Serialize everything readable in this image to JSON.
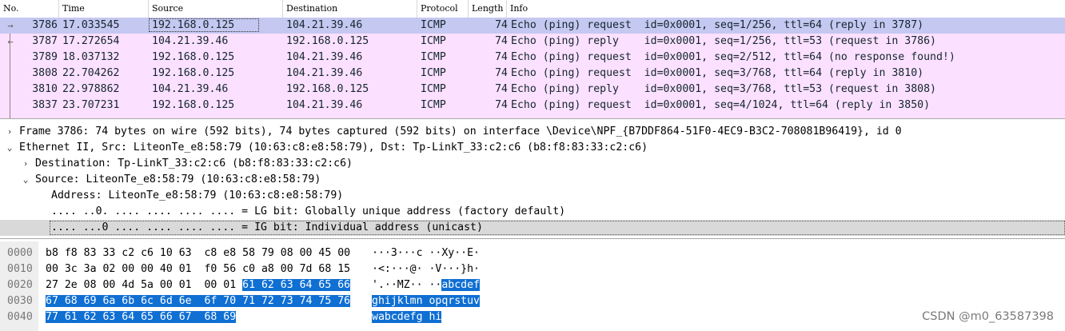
{
  "packet_list": {
    "columns": [
      "No.",
      "Time",
      "Source",
      "Destination",
      "Protocol",
      "Length",
      "Info"
    ],
    "rows": [
      {
        "no": "3786",
        "time": "17.033545",
        "src": "192.168.0.125",
        "dst": "104.21.39.46",
        "proto": "ICMP",
        "len": "74",
        "info": "Echo (ping) request  id=0x0001, seq=1/256, ttl=64 (reply in 3787)",
        "selected": true
      },
      {
        "no": "3787",
        "time": "17.272654",
        "src": "104.21.39.46",
        "dst": "192.168.0.125",
        "proto": "ICMP",
        "len": "74",
        "info": "Echo (ping) reply    id=0x0001, seq=1/256, ttl=53 (request in 3786)"
      },
      {
        "no": "3789",
        "time": "18.037132",
        "src": "192.168.0.125",
        "dst": "104.21.39.46",
        "proto": "ICMP",
        "len": "74",
        "info": "Echo (ping) request  id=0x0001, seq=2/512, ttl=64 (no response found!)"
      },
      {
        "no": "3808",
        "time": "22.704262",
        "src": "192.168.0.125",
        "dst": "104.21.39.46",
        "proto": "ICMP",
        "len": "74",
        "info": "Echo (ping) request  id=0x0001, seq=3/768, ttl=64 (reply in 3810)"
      },
      {
        "no": "3810",
        "time": "22.978862",
        "src": "104.21.39.46",
        "dst": "192.168.0.125",
        "proto": "ICMP",
        "len": "74",
        "info": "Echo (ping) reply    id=0x0001, seq=3/768, ttl=53 (request in 3808)"
      },
      {
        "no": "3837",
        "time": "23.707231",
        "src": "192.168.0.125",
        "dst": "104.21.39.46",
        "proto": "ICMP",
        "len": "74",
        "info": "Echo (ping) request  id=0x0001, seq=4/1024, ttl=64 (reply in 3850)"
      }
    ],
    "colors": {
      "row_bg": "#fce0ff",
      "selected_bg": "#c5c8f0",
      "text": "#12272e"
    }
  },
  "details": [
    {
      "toggle": "›",
      "indent": 0,
      "text": "Frame 3786: 74 bytes on wire (592 bits), 74 bytes captured (592 bits) on interface \\Device\\NPF_{B7DDF864-51F0-4EC9-B3C2-708081B96419}, id 0"
    },
    {
      "toggle": "⌄",
      "indent": 0,
      "text": "Ethernet II, Src: LiteonTe_e8:58:79 (10:63:c8:e8:58:79), Dst: Tp-LinkT_33:c2:c6 (b8:f8:83:33:c2:c6)"
    },
    {
      "toggle": "›",
      "indent": 1,
      "text": "Destination: Tp-LinkT_33:c2:c6 (b8:f8:83:33:c2:c6)"
    },
    {
      "toggle": "⌄",
      "indent": 1,
      "text": "Source: LiteonTe_e8:58:79 (10:63:c8:e8:58:79)"
    },
    {
      "toggle": "",
      "indent": 2,
      "text": "Address: LiteonTe_e8:58:79 (10:63:c8:e8:58:79)"
    },
    {
      "toggle": "",
      "indent": 2,
      "text": ".... ..0. .... .... .... .... = LG bit: Globally unique address (factory default)"
    },
    {
      "toggle": "",
      "indent": 2,
      "text": ".... ...0 .... .... .... .... = IG bit: Individual address (unicast)",
      "highlight": true
    }
  ],
  "bytes": {
    "offsets": [
      "0000",
      "0010",
      "0020",
      "0030",
      "0040"
    ],
    "lines": [
      {
        "hex": "b8 f8 83 33 c2 c6 10 63  c8 e8 58 79 08 00 45 00",
        "hex_hi": "",
        "ascii": "···3···c ··Xy··E·",
        "ascii_hi": ""
      },
      {
        "hex": "00 3c 3a 02 00 00 40 01  f0 56 c0 a8 00 7d 68 15",
        "hex_hi": "",
        "ascii": "·<:···@· ·V···}h·",
        "ascii_hi": ""
      },
      {
        "hex": "27 2e 08 00 4d 5a 00 01  00 01 ",
        "hex_hi": "61 62 63 64 65 66",
        "ascii": "'.··MZ·· ··",
        "ascii_hi": "abcdef"
      },
      {
        "hex": "",
        "hex_hi": "67 68 69 6a 6b 6c 6d 6e  6f 70 71 72 73 74 75 76",
        "ascii": "",
        "ascii_hi": "ghijklmn opqrstuv"
      },
      {
        "hex": "",
        "hex_hi": "77 61 62 63 64 65 66 67  68 69",
        "ascii": "",
        "ascii_hi": "wabcdefg hi"
      }
    ]
  },
  "watermark": "CSDN @m0_63587398"
}
